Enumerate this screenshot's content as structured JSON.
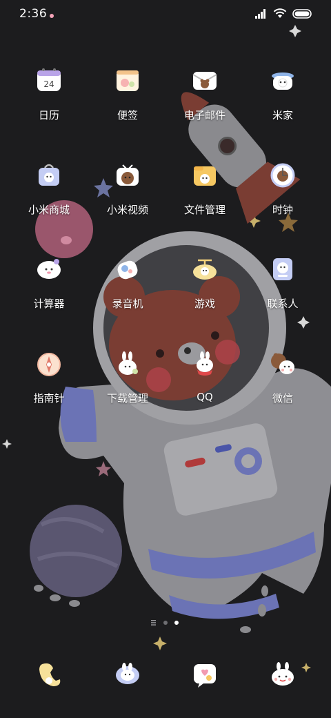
{
  "status": {
    "time": "2:36"
  },
  "apps": [
    {
      "label": "日历",
      "date": "24",
      "icon": "calendar-icon"
    },
    {
      "label": "便签",
      "icon": "notes-icon"
    },
    {
      "label": "电子邮件",
      "icon": "email-icon"
    },
    {
      "label": "米家",
      "icon": "mijia-icon"
    },
    {
      "label": "小米商城",
      "icon": "mi-store-icon"
    },
    {
      "label": "小米视频",
      "icon": "mi-video-icon"
    },
    {
      "label": "文件管理",
      "icon": "file-manager-icon"
    },
    {
      "label": "时钟",
      "icon": "clock-icon"
    },
    {
      "label": "计算器",
      "icon": "calculator-icon"
    },
    {
      "label": "录音机",
      "icon": "recorder-icon"
    },
    {
      "label": "游戏",
      "icon": "games-icon"
    },
    {
      "label": "联系人",
      "icon": "contacts-icon"
    },
    {
      "label": "指南针",
      "icon": "compass-icon"
    },
    {
      "label": "下载管理",
      "icon": "downloads-icon"
    },
    {
      "label": "QQ",
      "icon": "qq-icon"
    },
    {
      "label": "微信",
      "icon": "wechat-icon"
    }
  ],
  "dock": [
    {
      "icon": "phone-icon"
    },
    {
      "icon": "messages-icon"
    },
    {
      "icon": "browser-icon"
    },
    {
      "icon": "camera-icon"
    }
  ],
  "pager": {
    "pages": 2,
    "current_page": 2
  },
  "colors": {
    "background": "#1c1c1e",
    "astronaut_suit": "#8e8e93",
    "bear": "#7a3d33",
    "accent_blue": "#6b73b5",
    "planet_pink": "#b0607a"
  }
}
